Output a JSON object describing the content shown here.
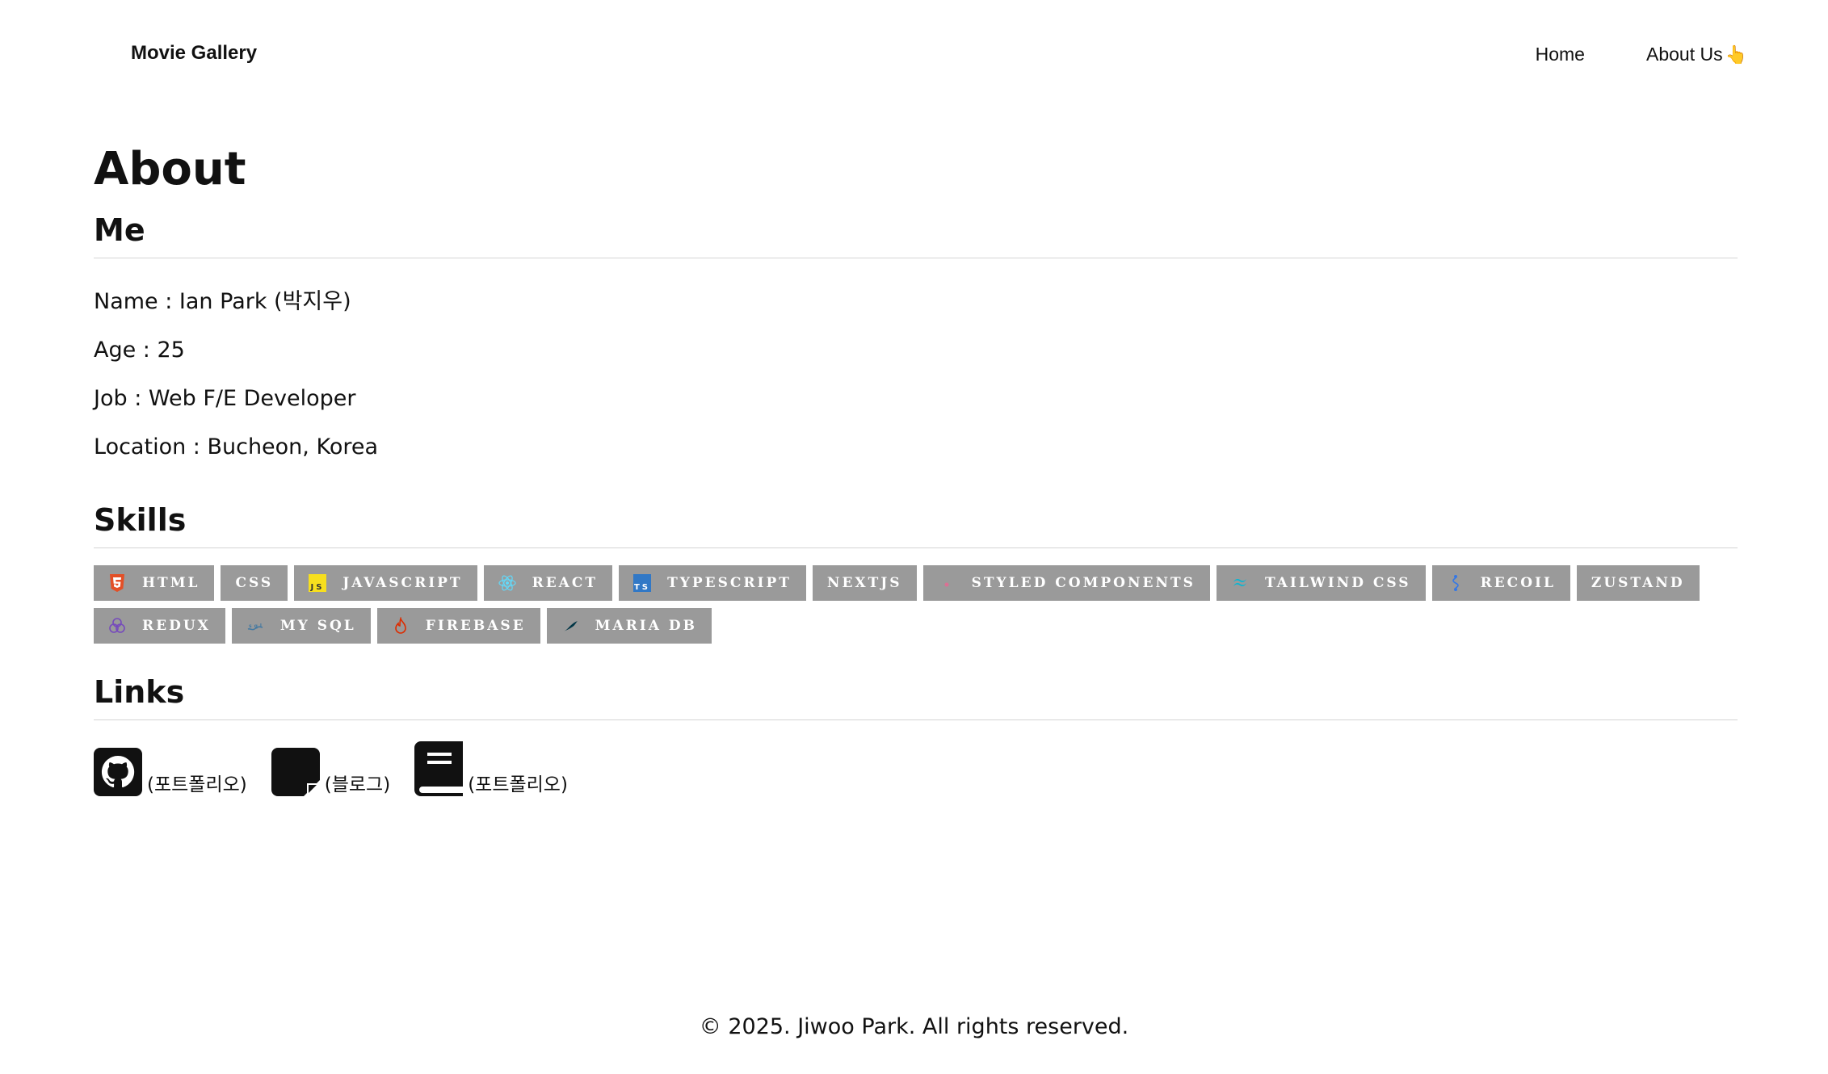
{
  "header": {
    "brand": "Movie Gallery",
    "nav": [
      {
        "label": "Home"
      },
      {
        "label": "About Us",
        "icon": "pointing-hand-icon"
      }
    ]
  },
  "page": {
    "title": "About"
  },
  "me": {
    "heading": "Me",
    "name": "Name : Ian Park (박지우)",
    "age": "Age : 25",
    "job": "Job : Web F/E Developer",
    "location": "Location : Bucheon, Korea"
  },
  "skills": {
    "heading": "Skills",
    "badge_color": "#9a9a9a",
    "items": [
      {
        "label": "HTML",
        "icon": "html5-icon",
        "color": "#e34f26"
      },
      {
        "label": "CSS",
        "icon": "",
        "color": ""
      },
      {
        "label": "JAVASCRIPT",
        "icon": "javascript-icon",
        "color": "#f7df1e"
      },
      {
        "label": "REACT",
        "icon": "react-icon",
        "color": "#61dafb"
      },
      {
        "label": "TYPESCRIPT",
        "icon": "typescript-icon",
        "color": "#3178c6"
      },
      {
        "label": "NEXTJS",
        "icon": "",
        "color": ""
      },
      {
        "label": "STYLED COMPONENTS",
        "icon": "styled-components-icon",
        "color": "#db7093"
      },
      {
        "label": "TAILWIND CSS",
        "icon": "tailwind-icon",
        "color": "#06b6d4"
      },
      {
        "label": "RECOIL",
        "icon": "recoil-icon",
        "color": "#3578e5"
      },
      {
        "label": "ZUSTAND",
        "icon": "",
        "color": ""
      },
      {
        "label": "REDUX",
        "icon": "redux-icon",
        "color": "#764abc"
      },
      {
        "label": "MY SQL",
        "icon": "mysql-icon",
        "color": "#4479a1"
      },
      {
        "label": "FIREBASE",
        "icon": "firebase-icon",
        "color": "#dd2c00"
      },
      {
        "label": "MARIA DB",
        "icon": "mariadb-icon",
        "color": "#003545"
      }
    ]
  },
  "links": {
    "heading": "Links",
    "items": [
      {
        "label": "(포트폴리오)",
        "icon": "github-icon"
      },
      {
        "label": "(블로그)",
        "icon": "sticky-note-icon"
      },
      {
        "label": "(포트폴리오)",
        "icon": "book-icon"
      }
    ]
  },
  "footer": {
    "text": "© 2025. Jiwoo Park. All rights reserved."
  }
}
